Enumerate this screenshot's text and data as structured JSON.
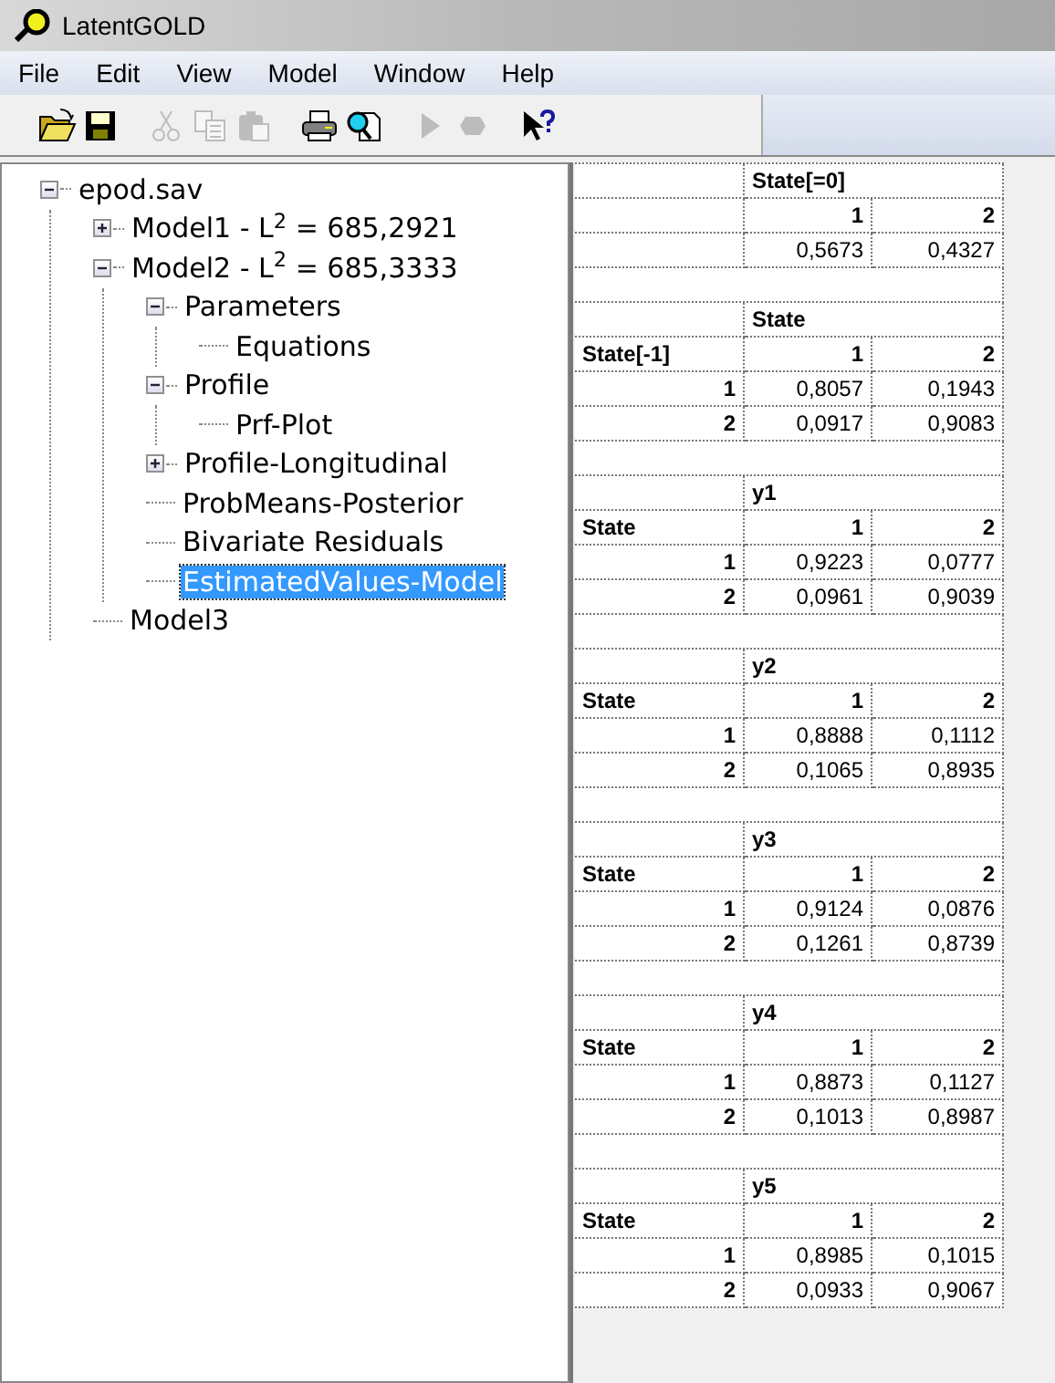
{
  "window": {
    "title": "LatentGOLD"
  },
  "menu": [
    "File",
    "Edit",
    "View",
    "Model",
    "Window",
    "Help"
  ],
  "toolbar": [
    {
      "kind": "open",
      "disabled": false
    },
    {
      "kind": "save",
      "disabled": false
    },
    {
      "kind": "cut",
      "disabled": true
    },
    {
      "kind": "copy",
      "disabled": true
    },
    {
      "kind": "paste",
      "disabled": true
    },
    {
      "kind": "print",
      "disabled": false
    },
    {
      "kind": "preview",
      "disabled": false
    },
    {
      "kind": "run",
      "disabled": true
    },
    {
      "kind": "stop",
      "disabled": true
    },
    {
      "kind": "help",
      "disabled": false
    }
  ],
  "tree": [
    {
      "label": "epod.sav",
      "expanded": true,
      "selected": false,
      "children": [
        {
          "label": "Model1 - L$^{2}$ = 685,2921",
          "expanded": false,
          "selected": false
        },
        {
          "label": "Model2 - L$^{2}$ = 685,3333",
          "expanded": true,
          "selected": false,
          "children": [
            {
              "label": "Parameters",
              "expanded": true,
              "selected": false,
              "children": [
                {
                  "label": "Equations",
                  "selected": false
                }
              ]
            },
            {
              "label": "Profile",
              "expanded": true,
              "selected": false,
              "children": [
                {
                  "label": "Prf-Plot",
                  "selected": false
                }
              ]
            },
            {
              "label": "Profile-Longitudinal",
              "expanded": false,
              "selected": false
            },
            {
              "label": "ProbMeans-Posterior",
              "selected": false
            },
            {
              "label": "Bivariate Residuals",
              "selected": false
            },
            {
              "label": "EstimatedValues-Model",
              "selected": true
            }
          ]
        },
        {
          "label": "Model3",
          "selected": false
        }
      ]
    }
  ],
  "tables": [
    {
      "title": "State[=0]",
      "columns": [
        "1",
        "2"
      ],
      "rows": [
        {
          "values": [
            "0,5673",
            "0,4327"
          ]
        }
      ]
    },
    {
      "title": "State",
      "row_header": "State[-1]",
      "columns": [
        "1",
        "2"
      ],
      "rows": [
        {
          "label": "1",
          "values": [
            "0,8057",
            "0,1943"
          ]
        },
        {
          "label": "2",
          "values": [
            "0,0917",
            "0,9083"
          ]
        }
      ]
    },
    {
      "title": "y1",
      "row_header": "State",
      "columns": [
        "1",
        "2"
      ],
      "rows": [
        {
          "label": "1",
          "values": [
            "0,9223",
            "0,0777"
          ]
        },
        {
          "label": "2",
          "values": [
            "0,0961",
            "0,9039"
          ]
        }
      ]
    },
    {
      "title": "y2",
      "row_header": "State",
      "columns": [
        "1",
        "2"
      ],
      "rows": [
        {
          "label": "1",
          "values": [
            "0,8888",
            "0,1112"
          ]
        },
        {
          "label": "2",
          "values": [
            "0,1065",
            "0,8935"
          ]
        }
      ]
    },
    {
      "title": "y3",
      "row_header": "State",
      "columns": [
        "1",
        "2"
      ],
      "rows": [
        {
          "label": "1",
          "values": [
            "0,9124",
            "0,0876"
          ]
        },
        {
          "label": "2",
          "values": [
            "0,1261",
            "0,8739"
          ]
        }
      ]
    },
    {
      "title": "y4",
      "row_header": "State",
      "columns": [
        "1",
        "2"
      ],
      "rows": [
        {
          "label": "1",
          "values": [
            "0,8873",
            "0,1127"
          ]
        },
        {
          "label": "2",
          "values": [
            "0,1013",
            "0,8987"
          ]
        }
      ]
    },
    {
      "title": "y5",
      "row_header": "State",
      "columns": [
        "1",
        "2"
      ],
      "rows": [
        {
          "label": "1",
          "values": [
            "0,8985",
            "0,1015"
          ]
        },
        {
          "label": "2",
          "values": [
            "0,0933",
            "0,9067"
          ]
        }
      ]
    }
  ]
}
